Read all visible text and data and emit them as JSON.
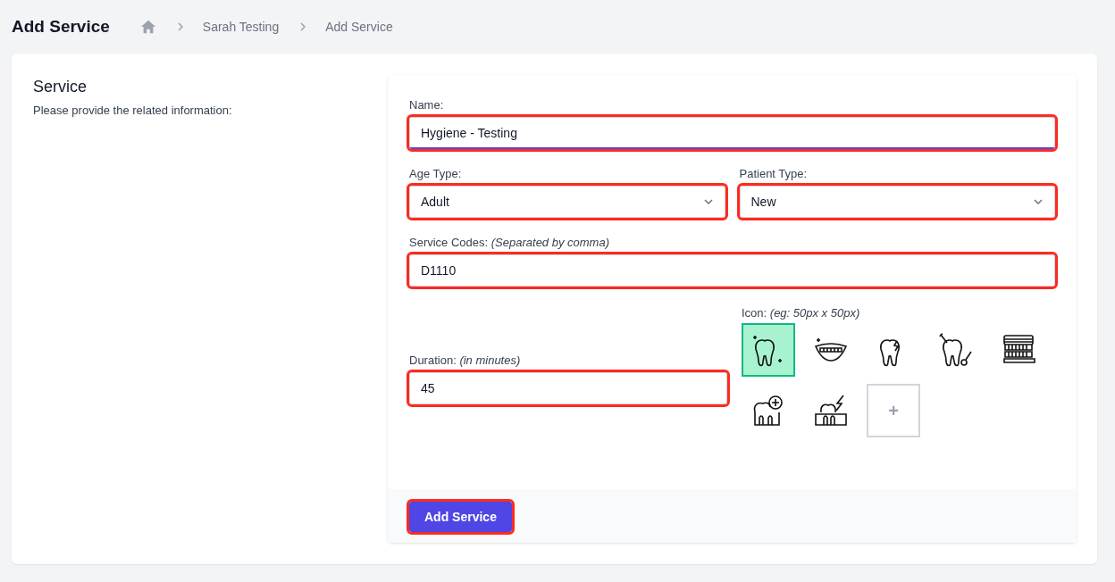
{
  "header": {
    "title": "Add Service",
    "breadcrumb": [
      "Sarah Testing",
      "Add Service"
    ]
  },
  "section": {
    "title": "Service",
    "description": "Please provide the related information:"
  },
  "form": {
    "name": {
      "label": "Name:",
      "value": "Hygiene - Testing",
      "highlighted": true,
      "focused": true
    },
    "age_type": {
      "label": "Age Type:",
      "value": "Adult",
      "highlighted": true
    },
    "patient_type": {
      "label": "Patient Type:",
      "value": "New",
      "highlighted": true
    },
    "service_codes": {
      "label": "Service Codes: *(Separated by comma)*",
      "value": "D1110",
      "highlighted": true
    },
    "duration": {
      "label": "Duration: *(in minutes)*",
      "value": "45",
      "highlighted": true
    },
    "icon": {
      "label": "Icon: *(eg: 50px x 50px)*",
      "options": [
        {
          "kind": "sparkle-tooth",
          "selected": true
        },
        {
          "kind": "smile",
          "selected": false
        },
        {
          "kind": "cracked-tooth",
          "selected": false
        },
        {
          "kind": "tooth-tools",
          "selected": false
        },
        {
          "kind": "dentures",
          "selected": false
        },
        {
          "kind": "tooth-plus",
          "selected": false
        },
        {
          "kind": "tooth-pain",
          "selected": false
        }
      ],
      "add_label": "+"
    },
    "submit": {
      "label": "Add Service",
      "highlighted": true
    }
  }
}
